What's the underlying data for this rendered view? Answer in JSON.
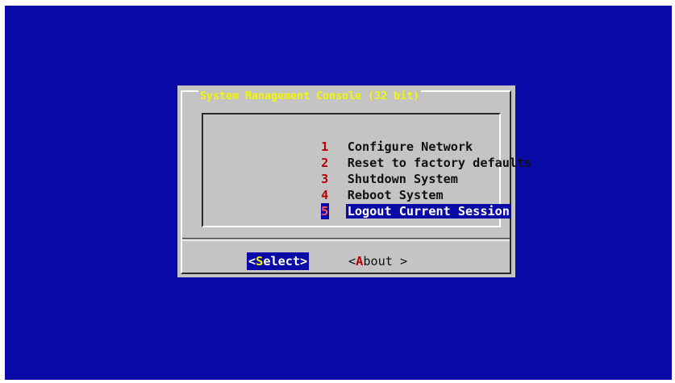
{
  "dialog": {
    "title": "System Management Console (32 bit)"
  },
  "menu": {
    "items": [
      {
        "key": "1",
        "label": "Configure Network",
        "selected": false
      },
      {
        "key": "2",
        "label": "Reset to factory defaults",
        "selected": false
      },
      {
        "key": "3",
        "label": "Shutdown System",
        "selected": false
      },
      {
        "key": "4",
        "label": "Reboot System",
        "selected": false
      },
      {
        "key": "5",
        "label": "Logout Current Session",
        "selected": true
      }
    ]
  },
  "buttons": {
    "select": {
      "open": "<",
      "hotkey": "S",
      "rest": "elect",
      "close": ">"
    },
    "about": {
      "open": "<",
      "hotkey": "A",
      "rest": "bout",
      "close": " >"
    }
  },
  "colors": {
    "screen_background": "#0a0aa8",
    "dialog_background": "#c4c4c4",
    "title_text": "#f5f500",
    "hotkey_red": "#b80000",
    "selection_background": "#0a0aa8"
  }
}
